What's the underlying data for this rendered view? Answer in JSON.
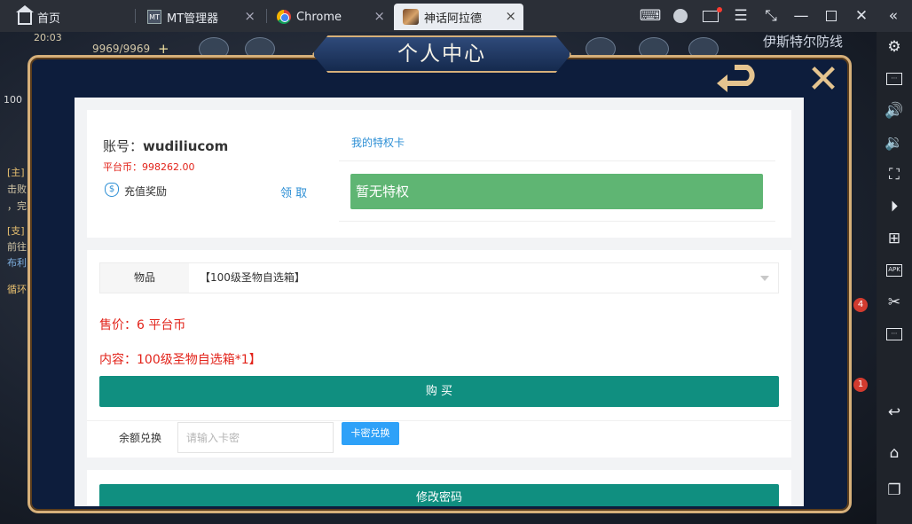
{
  "tabs": [
    {
      "label": "首页",
      "icon": "home-icon"
    },
    {
      "label": "MT管理器",
      "icon": "mt-manager-icon"
    },
    {
      "label": "Chrome",
      "icon": "chrome-icon"
    },
    {
      "label": "神话阿拉德",
      "icon": "game-icon"
    }
  ],
  "tab_close": "×",
  "game": {
    "time": "20:03",
    "hp": "9969/9969",
    "plus": "+",
    "location": "伊斯特尔防线",
    "badge1": "4",
    "badge2": "1",
    "left_texts": [
      "[主]",
      "击败",
      "，完",
      "[支]",
      "前往",
      "布利",
      "循环"
    ],
    "lv": "100"
  },
  "panel": {
    "title": "个人中心",
    "account_label": "账号：",
    "account_value": "wudiliucom",
    "balance_label": "平台币：",
    "balance_value": "998262.00",
    "recharge_label": "充值奖励",
    "claim_label": "领 取",
    "privilege_title": "我的特权卡",
    "privilege_status": "暂无特权",
    "item_label": "物品",
    "item_selected": "【100级圣物自选箱】",
    "price_text": "售价：6 平台币",
    "content_text": "内容：100级圣物自选箱*1】",
    "buy_label": "购 买",
    "redeem_label": "余额兑换",
    "redeem_placeholder": "请输入卡密",
    "redeem_button": "卡密兑换",
    "change_password": "修改密码"
  },
  "colors": {
    "accent_teal": "#108f80",
    "privilege_green": "#5fb573",
    "link_blue": "#2d8fd5",
    "price_red": "#e2231a",
    "redeem_blue": "#2ea1f8"
  }
}
